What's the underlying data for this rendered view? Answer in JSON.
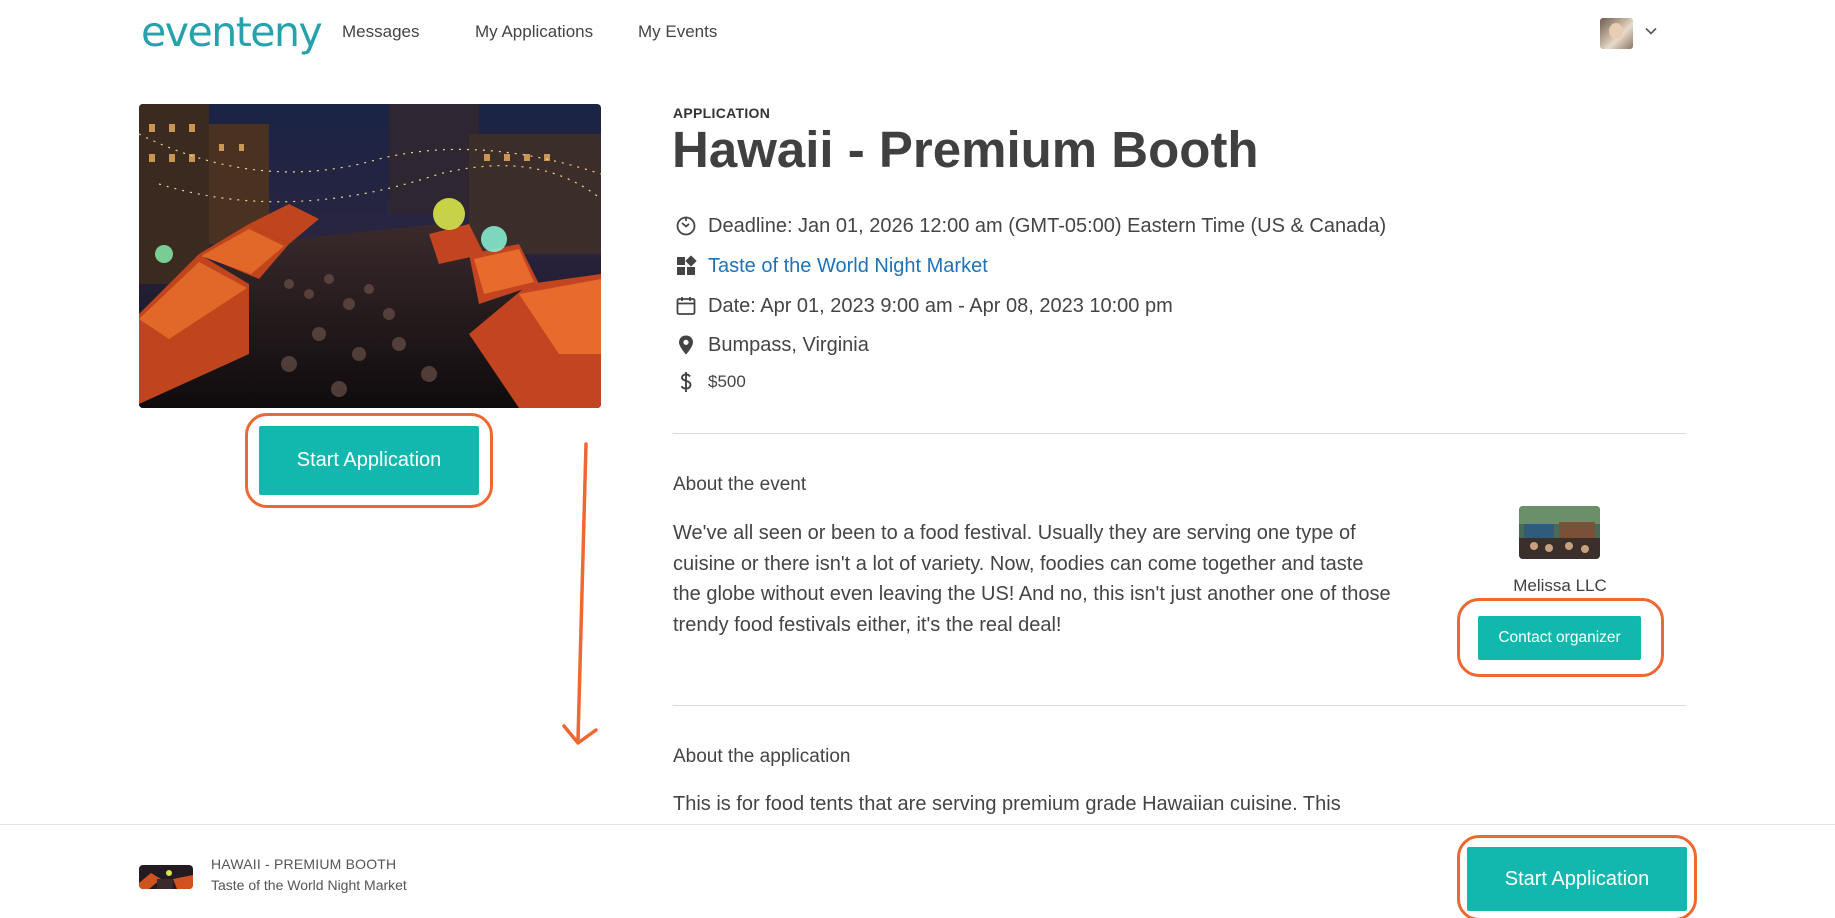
{
  "header": {
    "logo": "eventeny",
    "nav": [
      "Messages",
      "My Applications",
      "My Events"
    ]
  },
  "application": {
    "kicker": "APPLICATION",
    "title": "Hawaii - Premium Booth",
    "deadline": "Deadline: Jan 01, 2026 12:00 am (GMT-05:00) Eastern Time (US & Canada)",
    "event_link": "Taste of the World Night Market",
    "date": "Date: Apr 01, 2023 9:00 am - Apr 08, 2023 10:00 pm",
    "location": "Bumpass, Virginia",
    "price": "$500",
    "start_button": "Start Application"
  },
  "about_event": {
    "heading": "About the event",
    "text": "We've all seen or been to a food festival. Usually they are serving one type of cuisine or there isn't a lot of variety. Now, foodies can come together and taste the globe without even leaving the US! And no, this isn't just another one of those trendy food festivals either, it's the real deal!"
  },
  "organizer": {
    "name": "Melissa LLC",
    "contact_button": "Contact organizer"
  },
  "about_application": {
    "heading": "About the application",
    "text": "This is for food tents that are serving premium grade Hawaiian cuisine. This"
  },
  "bottom_bar": {
    "title": "HAWAII - PREMIUM BOOTH",
    "subtitle": "Taste of the World Night Market",
    "start_button": "Start Application"
  },
  "colors": {
    "accent": "#12b8ae",
    "logo": "#27a2ac",
    "link": "#1f72b8",
    "annotation": "#ef6731"
  },
  "icons": [
    "chevron-down-icon",
    "timer-icon",
    "dashboard-icon",
    "calendar-icon",
    "location-pin-icon",
    "dollar-icon"
  ]
}
